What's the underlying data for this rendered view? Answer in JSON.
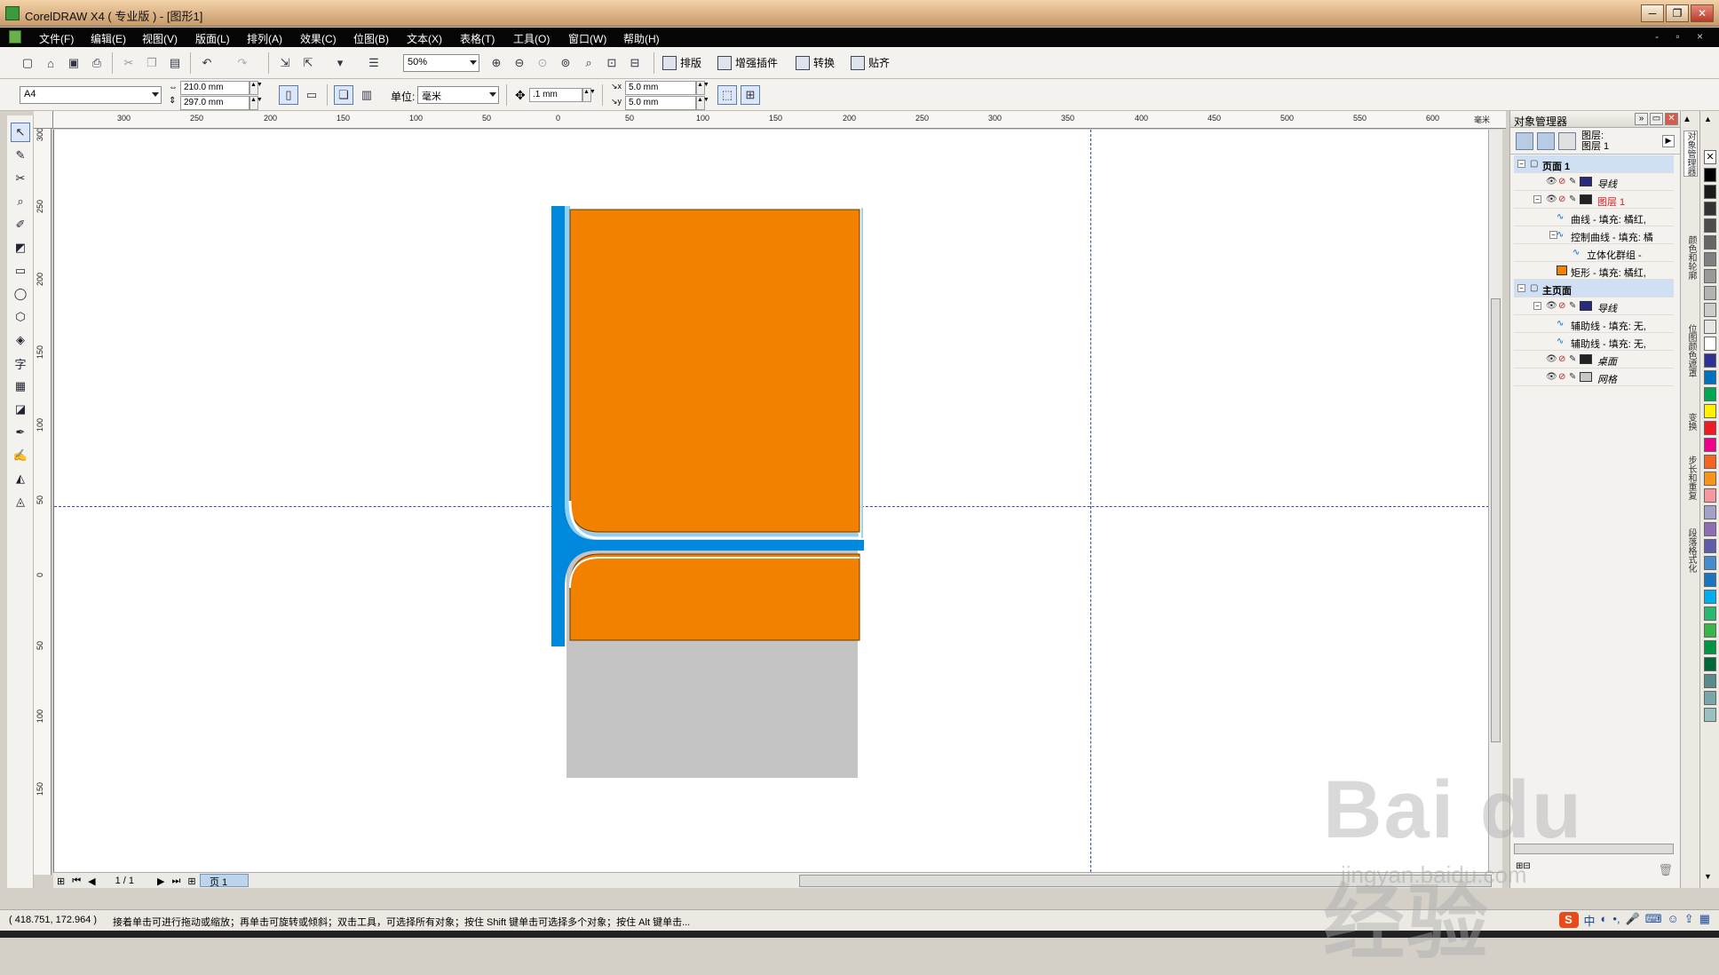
{
  "window": {
    "title": "CorelDRAW X4 ( 专业版 ) - [图形1]",
    "minimize": "─",
    "restore": "❐",
    "close": "✕"
  },
  "menu": {
    "items": [
      "文件(F)",
      "编辑(E)",
      "视图(V)",
      "版面(L)",
      "排列(A)",
      "效果(C)",
      "位图(B)",
      "文本(X)",
      "表格(T)",
      "工具(O)",
      "窗口(W)",
      "帮助(H)"
    ],
    "doc_buttons": "- ▫ ×"
  },
  "toolbar": {
    "zoom": "50%",
    "buttons": [
      "排版",
      "增强插件",
      "转换",
      "贴齐"
    ]
  },
  "property_bar": {
    "paper": "A4",
    "width": "210.0 mm",
    "height": "297.0 mm",
    "units_label": "单位:",
    "units": "毫米",
    "nudge": ".1 mm",
    "dup_x": "5.0 mm",
    "dup_y": "5.0 mm"
  },
  "rulers": {
    "h_ticks": [
      "300",
      "250",
      "200",
      "150",
      "100",
      "50",
      "0",
      "50",
      "100",
      "150",
      "200",
      "250",
      "300",
      "350",
      "400",
      "450",
      "500",
      "550",
      "600"
    ],
    "v_ticks": [
      "300",
      "250",
      "200",
      "150",
      "100",
      "50",
      "0",
      "50",
      "100",
      "150"
    ],
    "h_unit": "毫米"
  },
  "page_nav": {
    "counter": "1 / 1",
    "tab": "页 1"
  },
  "status": {
    "coords": "( 418.751, 172.964 )",
    "hint": "接着单击可进行拖动或缩放；再单击可旋转或倾斜；双击工具，可选择所有对象；按住 Shift 键单击可选择多个对象；按住 Alt 键单击..."
  },
  "object_manager": {
    "title": "对象管理器",
    "layer_label_1": "图层:",
    "layer_label_2": "图层 1",
    "tree": [
      {
        "label": "页面 1",
        "indent": 0,
        "bold": true,
        "kind": "page"
      },
      {
        "label": "导线",
        "indent": 1,
        "italic": true,
        "color": "#2a2a7a",
        "kind": "layer"
      },
      {
        "label": "图层 1",
        "indent": 1,
        "red": true,
        "color": "#222222",
        "kind": "layer"
      },
      {
        "label": "曲线 - 填充: 橘红,",
        "indent": 2,
        "kind": "object"
      },
      {
        "label": "控制曲线 - 填充: 橘",
        "indent": 2,
        "kind": "object"
      },
      {
        "label": "立体化群组 -",
        "indent": 3,
        "kind": "object"
      },
      {
        "label": "矩形 - 填充: 橘红,",
        "indent": 2,
        "color": "#f28100",
        "kind": "object"
      },
      {
        "label": "主页面",
        "indent": 0,
        "bold": true,
        "kind": "page"
      },
      {
        "label": "导线",
        "indent": 1,
        "italic": true,
        "color": "#2a2a7a",
        "kind": "layer"
      },
      {
        "label": "辅助线 - 填充: 无,",
        "indent": 2,
        "kind": "object"
      },
      {
        "label": "辅助线 - 填充: 无,",
        "indent": 2,
        "kind": "object"
      },
      {
        "label": "桌面",
        "indent": 1,
        "italic": true,
        "color": "#222222",
        "kind": "layer"
      },
      {
        "label": "网格",
        "indent": 1,
        "italic": true,
        "color": "#c8c8c8",
        "kind": "layer"
      }
    ]
  },
  "dock_tabs": [
    "对象管理器",
    "颜色和轮廓",
    "位图颜色遮罩",
    "变换",
    "步长和重复",
    "段落格式化"
  ],
  "palette_colors": [
    "#000000",
    "#1a1a1a",
    "#333333",
    "#4d4d4d",
    "#666666",
    "#808080",
    "#999999",
    "#b3b3b3",
    "#cccccc",
    "#e6e6e6",
    "#ffffff",
    "#2e3192",
    "#0071bc",
    "#00a651",
    "#fff200",
    "#ed1c24",
    "#ec008c",
    "#f26522",
    "#f7941d",
    "#f5989d",
    "#a3a1c8",
    "#8c6fb0",
    "#605ca8",
    "#448ccb",
    "#1b75bb",
    "#00aeef",
    "#2bb673",
    "#39b54a",
    "#009444",
    "#006838",
    "#5a8a8a",
    "#7aa6a6",
    "#9ac0c0"
  ],
  "ime": {
    "brand": "S",
    "mode": "中"
  },
  "watermark": {
    "big": "Bai  du 经验",
    "small": "jingyan.baidu.com"
  },
  "drawing": {
    "fill": "#f28100",
    "frame": "#0088dd"
  }
}
